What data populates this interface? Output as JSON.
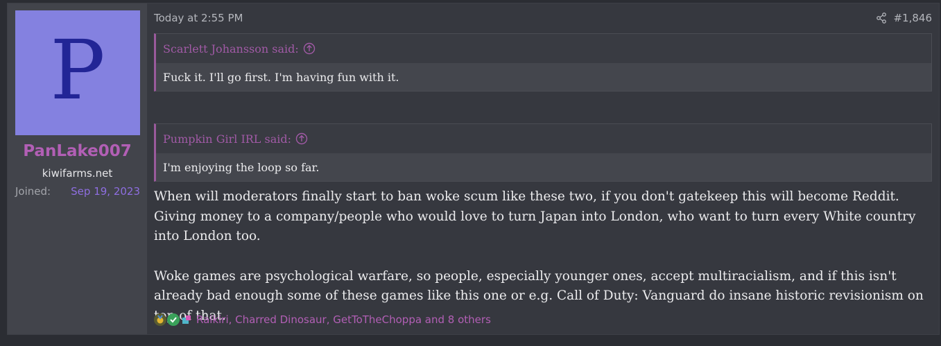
{
  "user": {
    "avatar_letter": "P",
    "name": "PanLake007",
    "title": "kiwifarms.net",
    "joined_label": "Joined:",
    "joined_value": "Sep 19, 2023"
  },
  "post": {
    "time": "Today at 2:55 PM",
    "number": "#1,846",
    "quotes": [
      {
        "author": "Scarlett Johansson said:",
        "text": "Fuck it. I'll go first. I'm having fun with it."
      },
      {
        "author": "Pumpkin Girl IRL said:",
        "text": "I'm enjoying the loop so far."
      }
    ],
    "paragraphs": [
      "When will moderators finally start to ban woke scum like these two, if you don't gatekeep this will become Reddit. Giving money to a company/people who would love to turn Japan into London, who want to turn every White country into London too.",
      "Woke games are psychological warfare, so people, especially younger ones, accept multiracialism, and if this isn't already bad enough some of these games like this one or e.g. Call of Duty: Vanguard do insane historic revisionism on top of that."
    ],
    "reactions_text": "Raikiri, Charred Dinosaur, GetToTheChoppa and 8 others"
  },
  "colors": {
    "avatar_bg": "#8481e0",
    "avatar_letter": "#222596",
    "username": "#b25fb5",
    "quote_accent": "#9a5a9c"
  },
  "icons": [
    "share-icon",
    "quote-jump-icon",
    "medal-reaction-icon",
    "check-reaction-icon",
    "puzzle-reaction-icon"
  ]
}
